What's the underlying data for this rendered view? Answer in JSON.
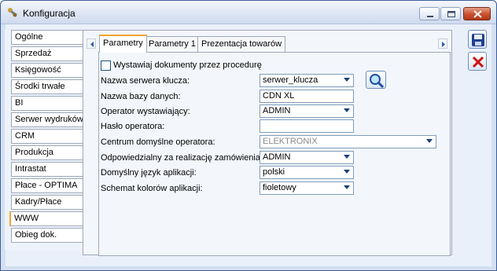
{
  "window": {
    "title": "Konfiguracja"
  },
  "left_tabs": [
    {
      "label": "Ogólne"
    },
    {
      "label": "Sprzedaż"
    },
    {
      "label": "Księgowość"
    },
    {
      "label": "Środki trwałe"
    },
    {
      "label": "BI"
    },
    {
      "label": "Serwer wydruków"
    },
    {
      "label": "CRM"
    },
    {
      "label": "Produkcja"
    },
    {
      "label": "Intrastat"
    },
    {
      "label": "Płace - OPTIMA"
    },
    {
      "label": "Kadry/Płace"
    },
    {
      "label": "WWW",
      "active": true
    },
    {
      "label": "Obieg dok."
    }
  ],
  "top_tabs": [
    {
      "label": "Parametry",
      "active": true
    },
    {
      "label": "Parametry 1"
    },
    {
      "label": "Prezentacja towarów"
    }
  ],
  "form": {
    "checkbox_label": "Wystawiaj dokumenty przez procedurę",
    "checkbox_checked": false,
    "server_label": "Nazwa serwera klucza:",
    "server_value": "serwer_klucza",
    "db_label": "Nazwa bazy danych:",
    "db_value": "CDN XL",
    "operator_label": "Operator wystawiający:",
    "operator_value": "ADMIN",
    "password_label": "Hasło operatora:",
    "password_value": "",
    "center_label": "Centrum domyślne operatora:",
    "center_value": "ELEKTRONIX",
    "responsible_label": "Odpowiedzialny za realizację zamówienia:",
    "responsible_value": "ADMIN",
    "language_label": "Domyślny język aplikacji:",
    "language_value": "polski",
    "color_label": "Schemat kolorów aplikacji:",
    "color_value": "fioletowy"
  },
  "colors": {
    "accent_tab": "#f0a530",
    "close_red": "#c94f2c",
    "save_blue": "#1f3f8f",
    "cancel_red": "#d01010"
  }
}
